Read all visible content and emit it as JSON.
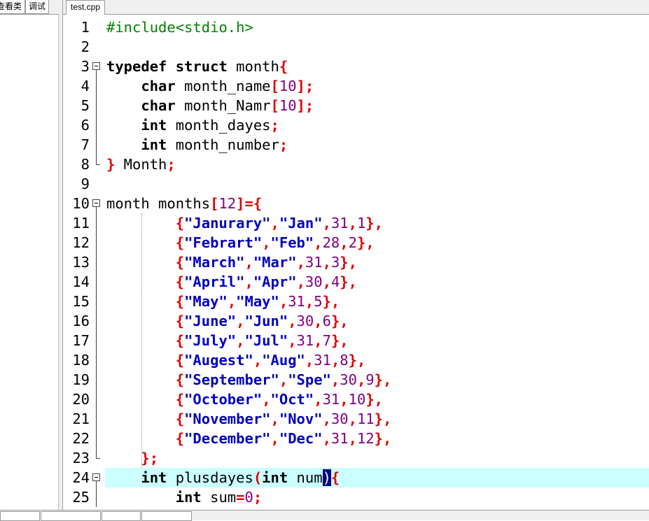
{
  "left_panel": {
    "tabs": [
      "查看类",
      "调试"
    ]
  },
  "editor": {
    "tab_label": "test.cpp",
    "current_line": 24,
    "lines": [
      {
        "n": "1",
        "tokens": [
          {
            "t": "pp",
            "v": "#include<stdio.h>"
          }
        ]
      },
      {
        "n": "2",
        "tokens": []
      },
      {
        "n": "3",
        "fold": "start",
        "tokens": [
          {
            "t": "kw",
            "v": "typedef"
          },
          {
            "t": "id",
            "v": " "
          },
          {
            "t": "kw",
            "v": "struct"
          },
          {
            "t": "id",
            "v": " month"
          },
          {
            "t": "op",
            "v": "{"
          }
        ]
      },
      {
        "n": "4",
        "fold": "mid",
        "tokens": [
          {
            "t": "id",
            "v": "    "
          },
          {
            "t": "kw",
            "v": "char"
          },
          {
            "t": "id",
            "v": " month_name"
          },
          {
            "t": "op",
            "v": "["
          },
          {
            "t": "num",
            "v": "10"
          },
          {
            "t": "op",
            "v": "];"
          }
        ]
      },
      {
        "n": "5",
        "fold": "mid",
        "tokens": [
          {
            "t": "id",
            "v": "    "
          },
          {
            "t": "kw",
            "v": "char"
          },
          {
            "t": "id",
            "v": " month_Namr"
          },
          {
            "t": "op",
            "v": "["
          },
          {
            "t": "num",
            "v": "10"
          },
          {
            "t": "op",
            "v": "];"
          }
        ]
      },
      {
        "n": "6",
        "fold": "mid",
        "tokens": [
          {
            "t": "id",
            "v": "    "
          },
          {
            "t": "kw",
            "v": "int"
          },
          {
            "t": "id",
            "v": " month_dayes"
          },
          {
            "t": "op",
            "v": ";"
          }
        ]
      },
      {
        "n": "7",
        "fold": "mid",
        "tokens": [
          {
            "t": "id",
            "v": "    "
          },
          {
            "t": "kw",
            "v": "int"
          },
          {
            "t": "id",
            "v": " month_number"
          },
          {
            "t": "op",
            "v": ";"
          }
        ]
      },
      {
        "n": "8",
        "fold": "end",
        "tokens": [
          {
            "t": "op",
            "v": "}"
          },
          {
            "t": "id",
            "v": " Month"
          },
          {
            "t": "op",
            "v": ";"
          }
        ]
      },
      {
        "n": "9",
        "tokens": []
      },
      {
        "n": "10",
        "fold": "start",
        "tokens": [
          {
            "t": "id",
            "v": "month months"
          },
          {
            "t": "op",
            "v": "["
          },
          {
            "t": "num",
            "v": "12"
          },
          {
            "t": "op",
            "v": "]={"
          }
        ]
      },
      {
        "n": "11",
        "fold": "mid",
        "tokens": [
          {
            "t": "id",
            "v": "        "
          },
          {
            "t": "op",
            "v": "{"
          },
          {
            "t": "str",
            "v": "\"Janurary\""
          },
          {
            "t": "op",
            "v": ","
          },
          {
            "t": "str",
            "v": "\"Jan\""
          },
          {
            "t": "op",
            "v": ","
          },
          {
            "t": "num",
            "v": "31"
          },
          {
            "t": "op",
            "v": ","
          },
          {
            "t": "num",
            "v": "1"
          },
          {
            "t": "op",
            "v": "},"
          }
        ]
      },
      {
        "n": "12",
        "fold": "mid",
        "tokens": [
          {
            "t": "id",
            "v": "        "
          },
          {
            "t": "op",
            "v": "{"
          },
          {
            "t": "str",
            "v": "\"Febrart\""
          },
          {
            "t": "op",
            "v": ","
          },
          {
            "t": "str",
            "v": "\"Feb\""
          },
          {
            "t": "op",
            "v": ","
          },
          {
            "t": "num",
            "v": "28"
          },
          {
            "t": "op",
            "v": ","
          },
          {
            "t": "num",
            "v": "2"
          },
          {
            "t": "op",
            "v": "},"
          }
        ]
      },
      {
        "n": "13",
        "fold": "mid",
        "tokens": [
          {
            "t": "id",
            "v": "        "
          },
          {
            "t": "op",
            "v": "{"
          },
          {
            "t": "str",
            "v": "\"March\""
          },
          {
            "t": "op",
            "v": ","
          },
          {
            "t": "str",
            "v": "\"Mar\""
          },
          {
            "t": "op",
            "v": ","
          },
          {
            "t": "num",
            "v": "31"
          },
          {
            "t": "op",
            "v": ","
          },
          {
            "t": "num",
            "v": "3"
          },
          {
            "t": "op",
            "v": "},"
          }
        ]
      },
      {
        "n": "14",
        "fold": "mid",
        "tokens": [
          {
            "t": "id",
            "v": "        "
          },
          {
            "t": "op",
            "v": "{"
          },
          {
            "t": "str",
            "v": "\"April\""
          },
          {
            "t": "op",
            "v": ","
          },
          {
            "t": "str",
            "v": "\"Apr\""
          },
          {
            "t": "op",
            "v": ","
          },
          {
            "t": "num",
            "v": "30"
          },
          {
            "t": "op",
            "v": ","
          },
          {
            "t": "num",
            "v": "4"
          },
          {
            "t": "op",
            "v": "},"
          }
        ]
      },
      {
        "n": "15",
        "fold": "mid",
        "tokens": [
          {
            "t": "id",
            "v": "        "
          },
          {
            "t": "op",
            "v": "{"
          },
          {
            "t": "str",
            "v": "\"May\""
          },
          {
            "t": "op",
            "v": ","
          },
          {
            "t": "str",
            "v": "\"May\""
          },
          {
            "t": "op",
            "v": ","
          },
          {
            "t": "num",
            "v": "31"
          },
          {
            "t": "op",
            "v": ","
          },
          {
            "t": "num",
            "v": "5"
          },
          {
            "t": "op",
            "v": "},"
          }
        ]
      },
      {
        "n": "16",
        "fold": "mid",
        "tokens": [
          {
            "t": "id",
            "v": "        "
          },
          {
            "t": "op",
            "v": "{"
          },
          {
            "t": "str",
            "v": "\"June\""
          },
          {
            "t": "op",
            "v": ","
          },
          {
            "t": "str",
            "v": "\"Jun\""
          },
          {
            "t": "op",
            "v": ","
          },
          {
            "t": "num",
            "v": "30"
          },
          {
            "t": "op",
            "v": ","
          },
          {
            "t": "num",
            "v": "6"
          },
          {
            "t": "op",
            "v": "},"
          }
        ]
      },
      {
        "n": "17",
        "fold": "mid",
        "tokens": [
          {
            "t": "id",
            "v": "        "
          },
          {
            "t": "op",
            "v": "{"
          },
          {
            "t": "str",
            "v": "\"July\""
          },
          {
            "t": "op",
            "v": ","
          },
          {
            "t": "str",
            "v": "\"Jul\""
          },
          {
            "t": "op",
            "v": ","
          },
          {
            "t": "num",
            "v": "31"
          },
          {
            "t": "op",
            "v": ","
          },
          {
            "t": "num",
            "v": "7"
          },
          {
            "t": "op",
            "v": "},"
          }
        ]
      },
      {
        "n": "18",
        "fold": "mid",
        "tokens": [
          {
            "t": "id",
            "v": "        "
          },
          {
            "t": "op",
            "v": "{"
          },
          {
            "t": "str",
            "v": "\"Augest\""
          },
          {
            "t": "op",
            "v": ","
          },
          {
            "t": "str",
            "v": "\"Aug\""
          },
          {
            "t": "op",
            "v": ","
          },
          {
            "t": "num",
            "v": "31"
          },
          {
            "t": "op",
            "v": ","
          },
          {
            "t": "num",
            "v": "8"
          },
          {
            "t": "op",
            "v": "},"
          }
        ]
      },
      {
        "n": "19",
        "fold": "mid",
        "tokens": [
          {
            "t": "id",
            "v": "        "
          },
          {
            "t": "op",
            "v": "{"
          },
          {
            "t": "str",
            "v": "\"September\""
          },
          {
            "t": "op",
            "v": ","
          },
          {
            "t": "str",
            "v": "\"Spe\""
          },
          {
            "t": "op",
            "v": ","
          },
          {
            "t": "num",
            "v": "30"
          },
          {
            "t": "op",
            "v": ","
          },
          {
            "t": "num",
            "v": "9"
          },
          {
            "t": "op",
            "v": "},"
          }
        ]
      },
      {
        "n": "20",
        "fold": "mid",
        "tokens": [
          {
            "t": "id",
            "v": "        "
          },
          {
            "t": "op",
            "v": "{"
          },
          {
            "t": "str",
            "v": "\"October\""
          },
          {
            "t": "op",
            "v": ","
          },
          {
            "t": "str",
            "v": "\"Oct\""
          },
          {
            "t": "op",
            "v": ","
          },
          {
            "t": "num",
            "v": "31"
          },
          {
            "t": "op",
            "v": ","
          },
          {
            "t": "num",
            "v": "10"
          },
          {
            "t": "op",
            "v": "},"
          }
        ]
      },
      {
        "n": "21",
        "fold": "mid",
        "tokens": [
          {
            "t": "id",
            "v": "        "
          },
          {
            "t": "op",
            "v": "{"
          },
          {
            "t": "str",
            "v": "\"November\""
          },
          {
            "t": "op",
            "v": ","
          },
          {
            "t": "str",
            "v": "\"Nov\""
          },
          {
            "t": "op",
            "v": ","
          },
          {
            "t": "num",
            "v": "30"
          },
          {
            "t": "op",
            "v": ","
          },
          {
            "t": "num",
            "v": "11"
          },
          {
            "t": "op",
            "v": "},"
          }
        ]
      },
      {
        "n": "22",
        "fold": "mid",
        "tokens": [
          {
            "t": "id",
            "v": "        "
          },
          {
            "t": "op",
            "v": "{"
          },
          {
            "t": "str",
            "v": "\"December\""
          },
          {
            "t": "op",
            "v": ","
          },
          {
            "t": "str",
            "v": "\"Dec\""
          },
          {
            "t": "op",
            "v": ","
          },
          {
            "t": "num",
            "v": "31"
          },
          {
            "t": "op",
            "v": ","
          },
          {
            "t": "num",
            "v": "12"
          },
          {
            "t": "op",
            "v": "},"
          }
        ]
      },
      {
        "n": "23",
        "fold": "end",
        "tokens": [
          {
            "t": "id",
            "v": "    "
          },
          {
            "t": "op",
            "v": "};"
          }
        ]
      },
      {
        "n": "24",
        "fold": "start",
        "tokens": [
          {
            "t": "id",
            "v": "    "
          },
          {
            "t": "kw",
            "v": "int"
          },
          {
            "t": "id",
            "v": " plusdayes"
          },
          {
            "t": "op",
            "v": "("
          },
          {
            "t": "kw",
            "v": "int"
          },
          {
            "t": "id",
            "v": " num"
          },
          {
            "t": "caret",
            "v": ")"
          },
          {
            "t": "op",
            "v": "{"
          }
        ]
      },
      {
        "n": "25",
        "fold": "mid",
        "tokens": [
          {
            "t": "id",
            "v": "        "
          },
          {
            "t": "kw",
            "v": "int"
          },
          {
            "t": "id",
            "v": " sum"
          },
          {
            "t": "op",
            "v": "="
          },
          {
            "t": "num",
            "v": "0"
          },
          {
            "t": "op",
            "v": ";"
          }
        ]
      }
    ]
  }
}
